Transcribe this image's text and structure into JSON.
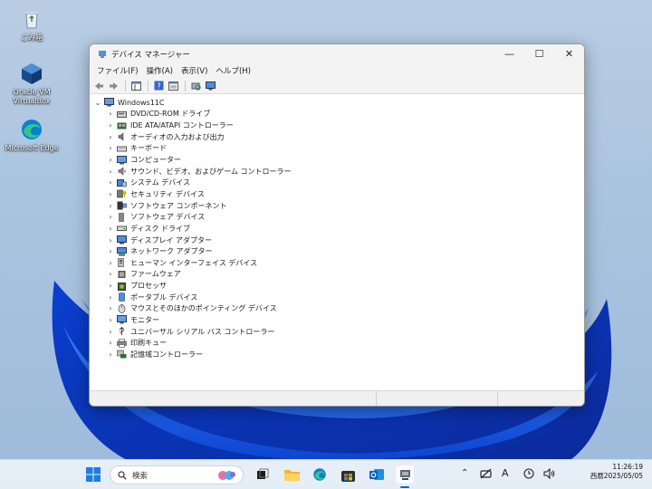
{
  "desktop": {
    "icons": [
      {
        "label": "ごみ箱",
        "icon": "recycle-bin-icon"
      },
      {
        "label": "Oracle VM VirtualBox",
        "icon": "virtualbox-icon"
      },
      {
        "label": "Microsoft Edge",
        "icon": "edge-icon"
      }
    ]
  },
  "window": {
    "title": "デバイス マネージャー",
    "controls": {
      "minimize": "—",
      "maximize": "☐",
      "close": "✕"
    },
    "menu": [
      "ファイル(F)",
      "操作(A)",
      "表示(V)",
      "ヘルプ(H)"
    ],
    "tree": {
      "root": "Windows11C",
      "categories": [
        {
          "label": "DVD/CD-ROM ドライブ",
          "icon": "dvd-drive-icon"
        },
        {
          "label": "IDE ATA/ATAPI コントローラー",
          "icon": "ide-controller-icon"
        },
        {
          "label": "オーディオの入力および出力",
          "icon": "speaker-icon"
        },
        {
          "label": "キーボード",
          "icon": "keyboard-icon"
        },
        {
          "label": "コンピューター",
          "icon": "computer-icon"
        },
        {
          "label": "サウンド、ビデオ、およびゲーム コントローラー",
          "icon": "sound-icon"
        },
        {
          "label": "システム デバイス",
          "icon": "system-device-icon"
        },
        {
          "label": "セキュリティ デバイス",
          "icon": "security-key-icon"
        },
        {
          "label": "ソフトウェア コンポーネント",
          "icon": "software-component-icon"
        },
        {
          "label": "ソフトウェア デバイス",
          "icon": "software-device-icon"
        },
        {
          "label": "ディスク ドライブ",
          "icon": "disk-drive-icon"
        },
        {
          "label": "ディスプレイ アダプター",
          "icon": "display-adapter-icon"
        },
        {
          "label": "ネットワーク アダプター",
          "icon": "network-adapter-icon"
        },
        {
          "label": "ヒューマン インターフェイス デバイス",
          "icon": "hid-icon"
        },
        {
          "label": "ファームウェア",
          "icon": "firmware-icon"
        },
        {
          "label": "プロセッサ",
          "icon": "processor-icon"
        },
        {
          "label": "ポータブル デバイス",
          "icon": "portable-device-icon"
        },
        {
          "label": "マウスとそのほかのポインティング デバイス",
          "icon": "mouse-icon"
        },
        {
          "label": "モニター",
          "icon": "monitor-icon"
        },
        {
          "label": "ユニバーサル シリアル バス コントローラー",
          "icon": "usb-icon"
        },
        {
          "label": "印刷キュー",
          "icon": "printer-icon"
        },
        {
          "label": "記憶域コントローラー",
          "icon": "storage-controller-icon"
        }
      ]
    }
  },
  "taskbar": {
    "search_placeholder": "検索",
    "clock": {
      "time": "11:26:19",
      "date": "西暦2025/05/05"
    },
    "tray": {
      "ime": "A"
    }
  },
  "colors": {
    "accent": "#0067c0",
    "window_chrome": "#f3f3f3",
    "taskbar": "#ecf2f8"
  }
}
